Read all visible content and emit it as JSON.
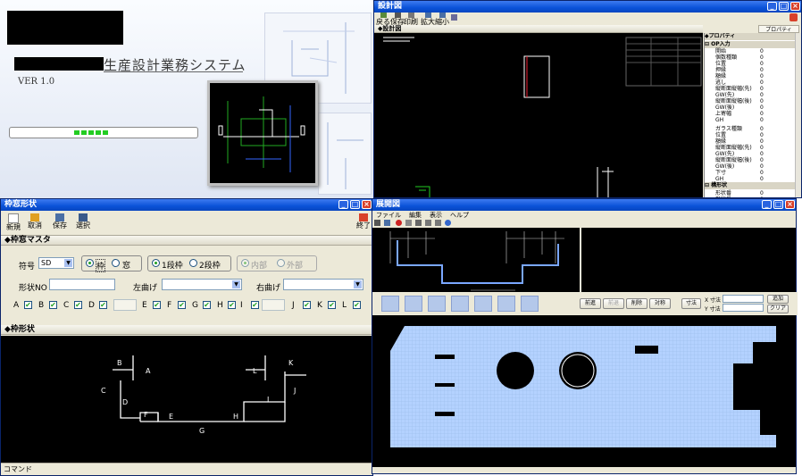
{
  "splash": {
    "system_title": "生産設計業務システム",
    "version": "VER  1.0",
    "progress_segments": 5
  },
  "design_window": {
    "title": "設計図",
    "toolbar": [
      "戻る",
      "保存",
      "印刷",
      "拡大",
      "縮小"
    ],
    "tab_label": "◆設計図",
    "property_tab": "プロパティ",
    "property_header": "◆プロパティ",
    "group1": "OP入力",
    "group1_rows": [
      {
        "label": "開始",
        "value": "0"
      },
      {
        "label": "個数種類",
        "value": "0"
      },
      {
        "label": "位置",
        "value": "0"
      },
      {
        "label": "押縁",
        "value": "0"
      },
      {
        "label": "額縁",
        "value": "0"
      },
      {
        "label": "逃し",
        "value": "0"
      },
      {
        "label": "縦断面縦幅(先)",
        "value": "0"
      },
      {
        "label": "GW(先)",
        "value": "0"
      },
      {
        "label": "縦断面縦幅(後)",
        "value": "0"
      },
      {
        "label": "GW(後)",
        "value": "0"
      },
      {
        "label": "上寄幅",
        "value": "0"
      },
      {
        "label": "GH",
        "value": "0"
      }
    ],
    "group2_rows": [
      {
        "label": "ガラス種類",
        "value": "0"
      },
      {
        "label": "位置",
        "value": "0"
      },
      {
        "label": "額縁",
        "value": "0"
      },
      {
        "label": "縦断面縦幅(先)",
        "value": "0"
      },
      {
        "label": "GW(先)",
        "value": "0"
      },
      {
        "label": "縦断面縦幅(後)",
        "value": "0"
      },
      {
        "label": "GW(後)",
        "value": "0"
      },
      {
        "label": "下寸",
        "value": "0"
      },
      {
        "label": "GH",
        "value": "0"
      }
    ],
    "group3": "構形状",
    "group3_rows": [
      {
        "label": "形状番",
        "value": "0"
      },
      {
        "label": "形状番",
        "value": "0"
      }
    ]
  },
  "frame_window": {
    "title": "枠窓形状",
    "toolbar": [
      "新規",
      "取消",
      "保存",
      "選択"
    ],
    "toolbar_right": "終了",
    "section1": "◆枠窓マスタ",
    "code_label": "符号",
    "code_value": "SD",
    "radio_waku": "枠",
    "radio_mado": "窓",
    "radio_1dan": "1段枠",
    "radio_2dan": "2段枠",
    "radio_inner": "内部",
    "radio_outer": "外部",
    "shape_no_label": "形状NO",
    "left_bend_label": "左曲げ",
    "right_bend_label": "右曲げ",
    "checks": [
      "A",
      "B",
      "C",
      "D",
      "E",
      "F",
      "G",
      "H",
      "I",
      "J",
      "K",
      "L"
    ],
    "section2": "◆枠形状",
    "shape_labels": [
      "A",
      "B",
      "C",
      "D",
      "E",
      "F",
      "G",
      "H",
      "I",
      "J",
      "K",
      "L"
    ],
    "status": "コマンド"
  },
  "unfold_window": {
    "title": "展開図",
    "menu": [
      "ファイル",
      "編集",
      "表示",
      "ヘルプ"
    ],
    "buttons": [
      "前進",
      "前退",
      "削除",
      "対称"
    ],
    "dim_button": "寸法",
    "x_label": "X 寸法",
    "y_label": "Y 寸法",
    "add_button": "追加",
    "clear_button": "クリア"
  },
  "colors": {
    "titlebar": "#0a52d8",
    "window_bg": "#ece9d8",
    "canvas": "#000000",
    "unfold_panel": "#b4d2ff",
    "shape_line": "#ffffff",
    "accent_green": "#21a121"
  }
}
